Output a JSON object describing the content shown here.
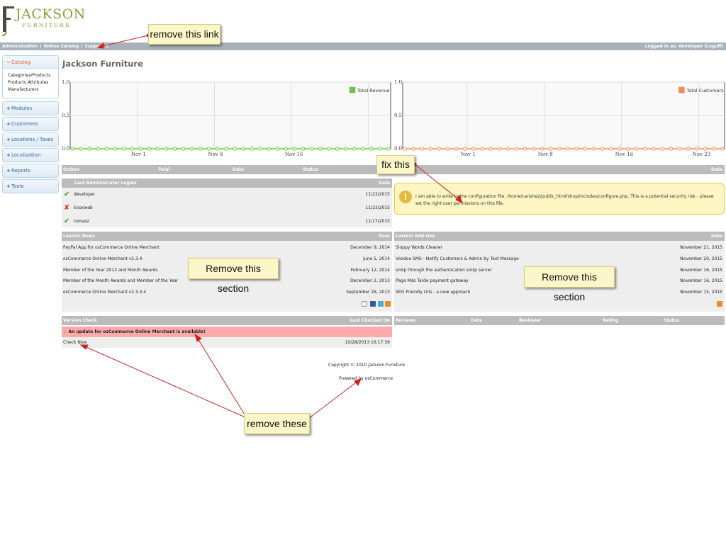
{
  "brand": {
    "logo_word": "JACKSON",
    "logo_sub": "FURNITURE"
  },
  "topbar": {
    "links": [
      "Administration",
      "Online Catalog",
      "Support S"
    ],
    "logged_in": "Logged in as: developer (Logoff)"
  },
  "sidebar": {
    "catalog": {
      "label": "Catalog",
      "toggle": "−",
      "items": [
        "Categories/Products",
        "Products Attributes",
        "Manufacturers"
      ]
    },
    "sections": [
      {
        "label": "Modules",
        "toggle": "+"
      },
      {
        "label": "Customers",
        "toggle": "+"
      },
      {
        "label": "Locations / Taxes",
        "toggle": "+"
      },
      {
        "label": "Localization",
        "toggle": "+"
      },
      {
        "label": "Reports",
        "toggle": "+"
      },
      {
        "label": "Tools",
        "toggle": "+"
      }
    ]
  },
  "page_title": "Jackson Furniture",
  "chart_data": [
    {
      "type": "line",
      "series": [
        {
          "name": "Total Revenue",
          "values": [
            0,
            0,
            0,
            0,
            0,
            0,
            0,
            0,
            0,
            0,
            0,
            0,
            0,
            0,
            0,
            0,
            0,
            0,
            0,
            0,
            0,
            0,
            0,
            0,
            0,
            0,
            0,
            0,
            0,
            0,
            0,
            0,
            0,
            0,
            0,
            0,
            0,
            0
          ]
        }
      ],
      "x_ticks": [
        "Nov 1",
        "Nov 8",
        "Nov 16"
      ],
      "y_ticks": [
        "0.0",
        "0.5",
        "1.0"
      ],
      "ylim": [
        0,
        1
      ],
      "grid": true,
      "legend": "top-right",
      "color": "#66cc33"
    },
    {
      "type": "line",
      "series": [
        {
          "name": "Total Customers",
          "values": [
            0,
            0,
            0,
            0,
            0,
            0,
            0,
            0,
            0,
            0,
            0,
            0,
            0,
            0,
            0,
            0,
            0,
            0,
            0,
            0,
            0,
            0,
            0,
            0,
            0,
            0,
            0,
            0,
            0,
            0,
            0,
            0,
            0,
            0,
            0,
            0,
            0,
            0
          ]
        }
      ],
      "x_ticks": [
        "Nov 1",
        "Nov 8",
        "Nov 16",
        "Nov 23"
      ],
      "y_ticks": [
        "0.0",
        "0.5",
        "1.0"
      ],
      "ylim": [
        0,
        1
      ],
      "grid": true,
      "legend": "top-right",
      "color": "#ff8855"
    }
  ],
  "orders": {
    "headers": [
      "Orders",
      "Total",
      "Date",
      "Status"
    ],
    "right_header": "Date"
  },
  "logins": {
    "header": "Last Administrator Logins",
    "date_header": "Date",
    "rows": [
      {
        "name": "developer",
        "date": "11/23/2015",
        "ok": "✔"
      },
      {
        "name": "knoxweb",
        "date": "11/23/2015",
        "ok": "✘"
      },
      {
        "name": "tomasz",
        "date": "11/17/2015",
        "ok": "✔"
      }
    ]
  },
  "warning": {
    "icon": "!",
    "text": "I am able to write to the configuration file: /home/carishe2/public_html/shop/includes/configure.php. This is a potential security risk - please set the right user permissions on this file."
  },
  "news": {
    "header": "Lastest News",
    "date_header": "Date",
    "rows": [
      {
        "title": "PayPal App for osCommerce Online Merchant",
        "date": "December 9, 2014"
      },
      {
        "title": "osCommerce Online Merchant v2.3.4",
        "date": "June 5, 2014"
      },
      {
        "title": "Member of the Year 2013 and Month Awards",
        "date": "February 12, 2014"
      },
      {
        "title": "Member of the Month Awards and Member of the Year",
        "date": "December 2, 2013"
      },
      {
        "title": "osCommerce Online Merchant v2.3.3.4",
        "date": "September 26, 2013"
      }
    ]
  },
  "addons": {
    "header": "Lastest Add-Ons",
    "date_header": "Date",
    "rows": [
      {
        "title": "Sloppy Words Cleaner",
        "date": "November 21, 2015"
      },
      {
        "title": "Voodoo SMS - Notify Customers & Admin by Text Message",
        "date": "November 20, 2015"
      },
      {
        "title": "smtp through the authentication smtp server",
        "date": "November 16, 2015"
      },
      {
        "title": "Paga Más Tarde payment gateway",
        "date": "November 16, 2015"
      },
      {
        "title": "SEO Friendly Urls - a new approach",
        "date": "November 15, 2015"
      }
    ]
  },
  "version": {
    "header": "Version Check",
    "checked_header": "Last Checked On",
    "alert": "An update for osCommerce Online Merchant is available!",
    "link": "Check Now",
    "checked": "10/28/2013 16:17:39"
  },
  "reviews": {
    "headers": [
      "Reviews",
      "Date",
      "Reviewer",
      "Rating",
      "Status"
    ]
  },
  "footer": {
    "copyright": "Copyright © 2010 Jackson Furniture",
    "powered": "Powered by osCommerce"
  },
  "annotations": {
    "remove_link": "remove this link",
    "fix_this": "fix this",
    "remove_section_1": "Remove this section",
    "remove_section_2": "Remove this section",
    "remove_these": "remove these"
  }
}
